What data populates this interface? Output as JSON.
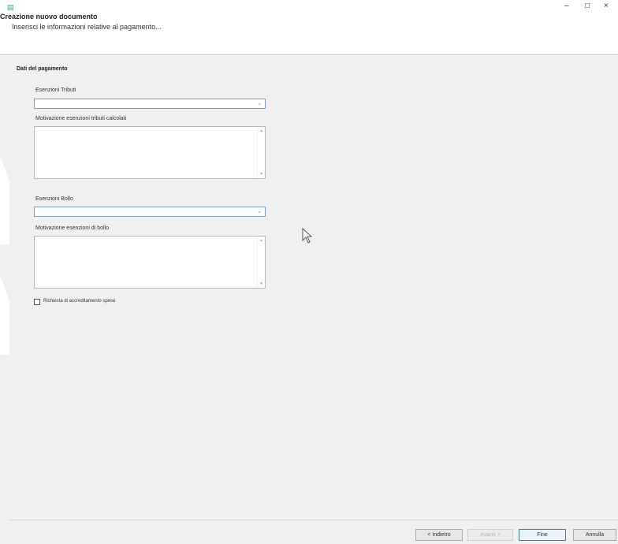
{
  "window": {
    "title": "Creazione nuovo documento",
    "subtitle": "Inserisci le informazioni relative al pagamento...",
    "min_label": "‒",
    "max_label": "□",
    "close_label": "×"
  },
  "section": {
    "title": "Dati del pagamento"
  },
  "fields": {
    "esenzioni_tributi_label": "Esenzioni Tributi",
    "esenzioni_tributi_value": "",
    "motivazione_tributi_label": "Motivazione esenzioni tributi calcolati",
    "motivazione_tributi_value": "",
    "esenzioni_bollo_label": "Esenzioni Bollo",
    "esenzioni_bollo_value": "",
    "motivazione_bollo_label": "Motivazione esenzioni di bollo",
    "motivazione_bollo_value": "",
    "accreditamento_label": "Richiesta di accreditamento spese"
  },
  "buttons": {
    "back": "< Indietro",
    "next": "Avanti >",
    "finish": "Fine",
    "cancel": "Annulla"
  }
}
